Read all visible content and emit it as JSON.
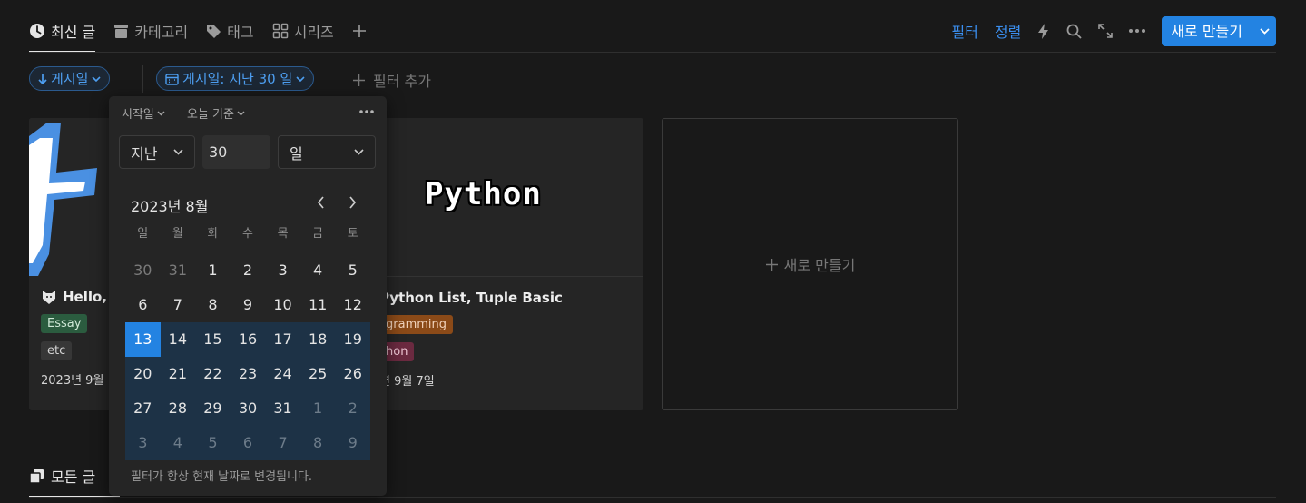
{
  "tabs": [
    {
      "label": "최신 글",
      "icon": "clock-icon",
      "active": true
    },
    {
      "label": "카테고리",
      "icon": "archive-icon"
    },
    {
      "label": "태그",
      "icon": "tag-icon"
    },
    {
      "label": "시리즈",
      "icon": "grid-icon"
    }
  ],
  "toolbar": {
    "filter": "필터",
    "sort": "정렬",
    "new_button": "새로 만들기"
  },
  "filters": {
    "sort_chip": "게시일",
    "date_chip": "게시일: 지난 30 일",
    "add_filter": "필터 추가"
  },
  "cards": [
    {
      "title": "Hello,",
      "tags": [
        {
          "label": "Essay",
          "color": "#2b5c3f",
          "fg": "#cfe8d6"
        },
        {
          "label": "etc",
          "color": "#373737",
          "fg": "#d4d4d4"
        }
      ],
      "date": "2023년 9월",
      "cover": "blue"
    },
    {
      "title": "Python List, Tuple Basic",
      "cover_text": "Python",
      "tags": [
        {
          "label": "gramming",
          "color": "#8b4a18",
          "fg": "#f1d2bb"
        },
        {
          "label": "hon",
          "color": "#6b2a40",
          "fg": "#f0c8d6"
        }
      ],
      "date": "년 9월 7일"
    }
  ],
  "new_card": "새로 만들기",
  "popup": {
    "mode": "시작일",
    "relative": "오늘 기준",
    "direction": "지난",
    "amount": "30",
    "unit": "일",
    "month": "2023년 8월",
    "weekdays": [
      "일",
      "월",
      "화",
      "수",
      "목",
      "금",
      "토"
    ],
    "weeks": [
      [
        "30",
        "31",
        "1",
        "2",
        "3",
        "4",
        "5"
      ],
      [
        "6",
        "7",
        "8",
        "9",
        "10",
        "11",
        "12"
      ],
      [
        "13",
        "14",
        "15",
        "16",
        "17",
        "18",
        "19"
      ],
      [
        "20",
        "21",
        "22",
        "23",
        "24",
        "25",
        "26"
      ],
      [
        "27",
        "28",
        "29",
        "30",
        "31",
        "1",
        "2"
      ],
      [
        "3",
        "4",
        "5",
        "6",
        "7",
        "8",
        "9"
      ]
    ],
    "footer": "필터가 항상 현재 날짜로 변경됩니다."
  },
  "bottom_tab": "모든 글"
}
